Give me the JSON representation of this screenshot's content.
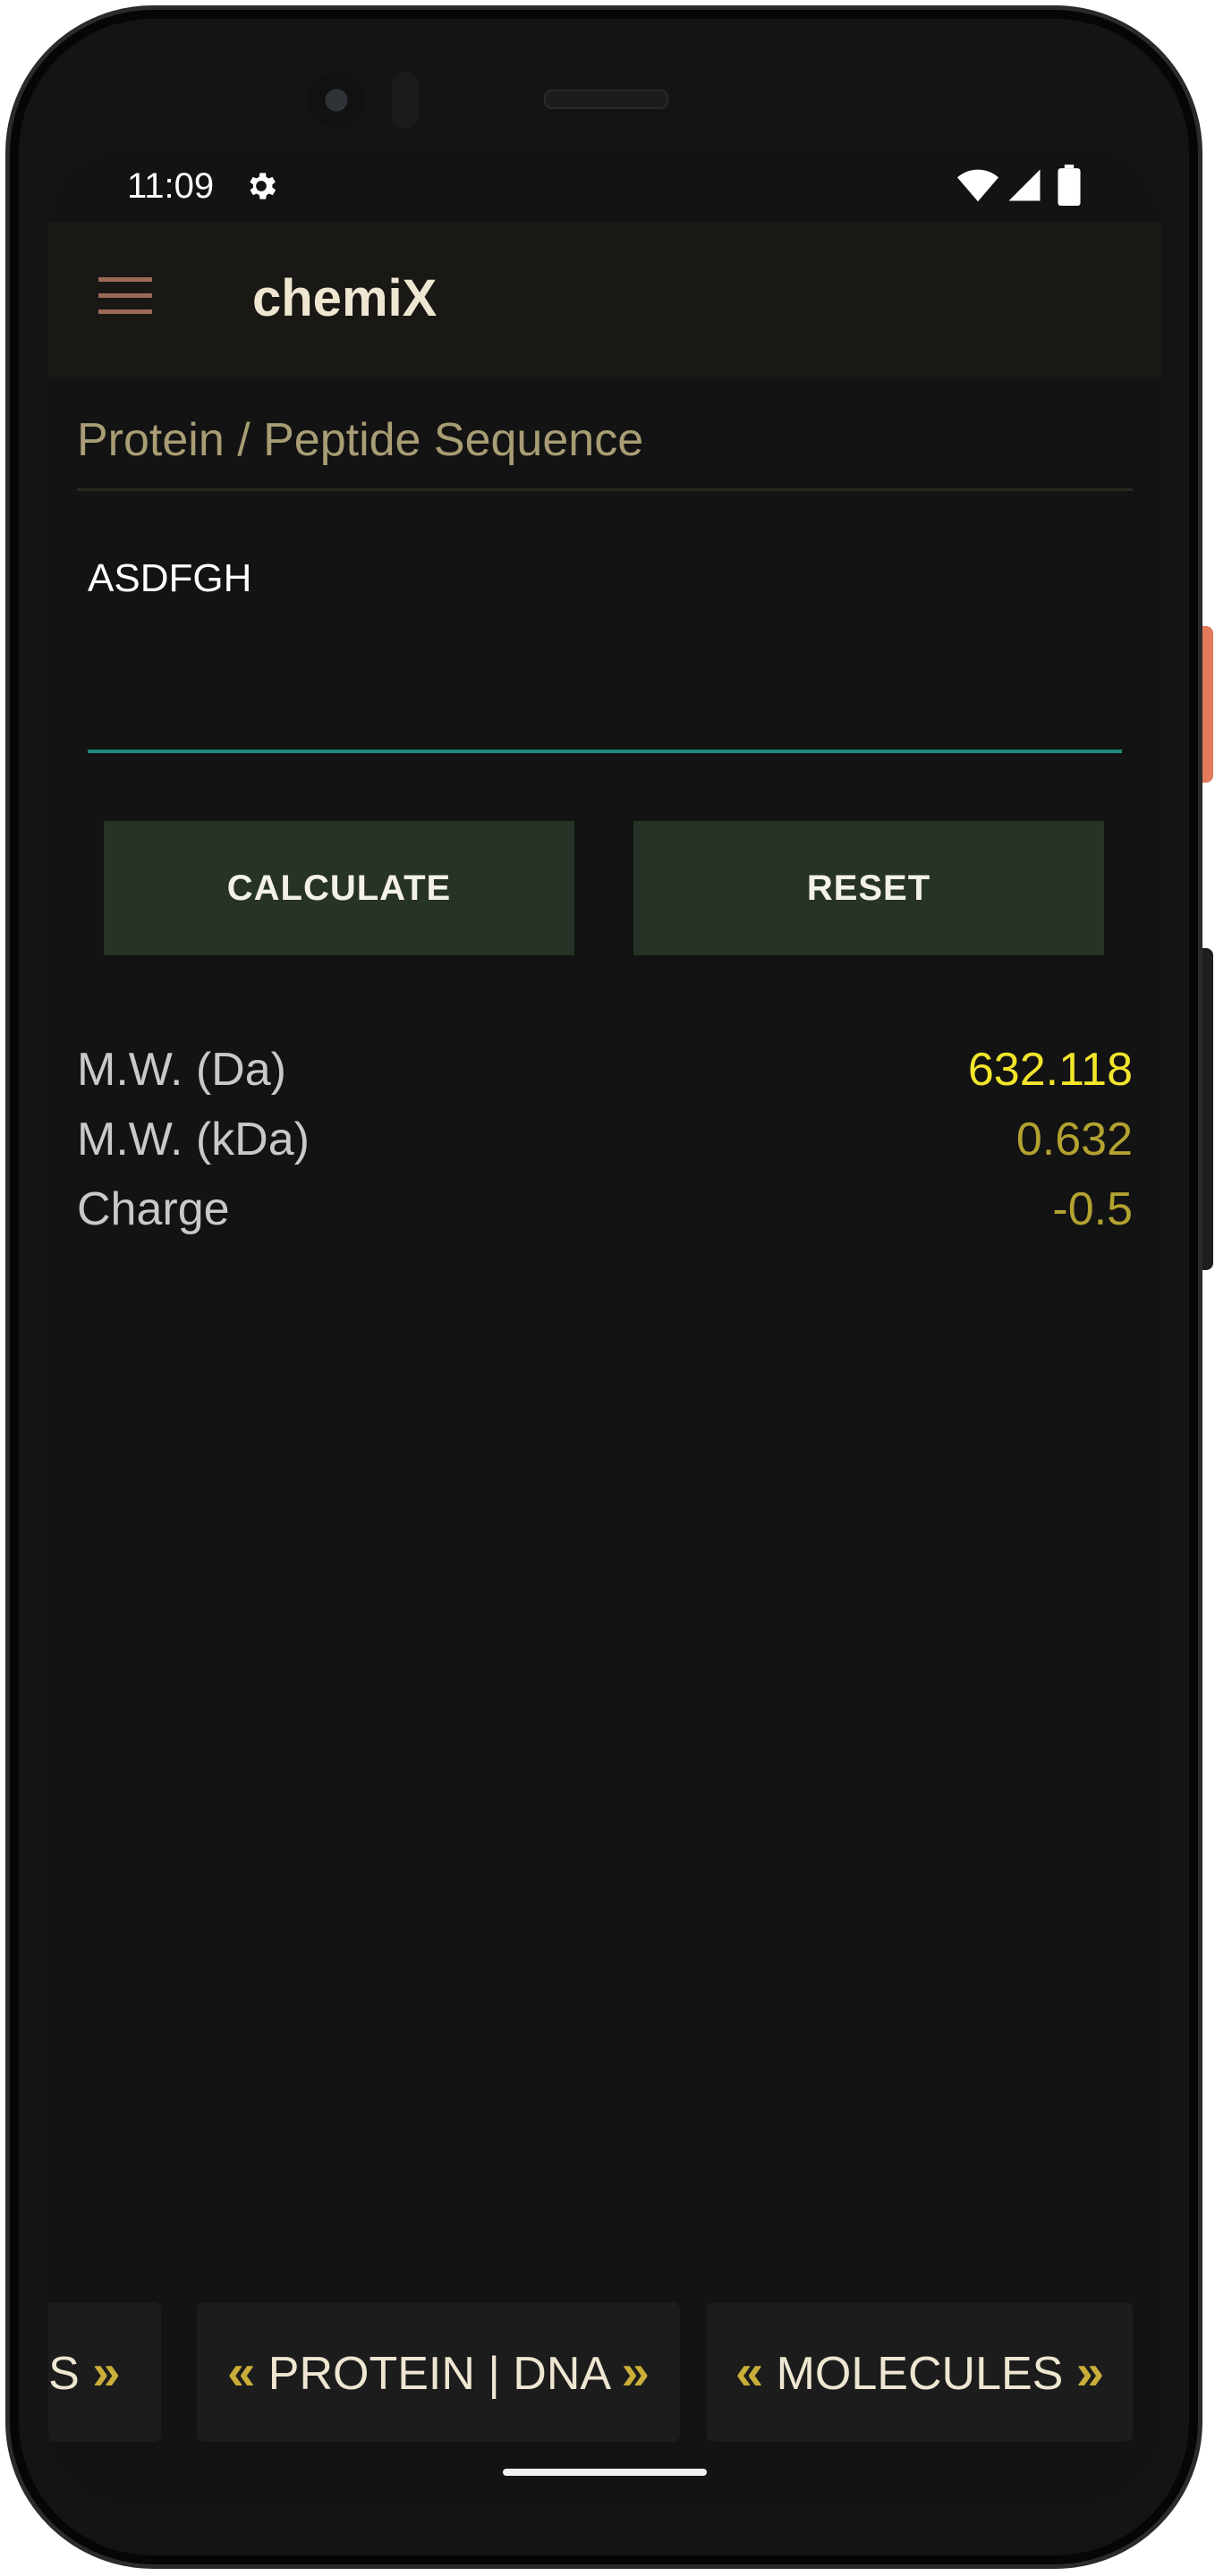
{
  "status_bar": {
    "time": "11:09",
    "icons": [
      "gear-icon",
      "wifi-icon",
      "signal-icon",
      "battery-icon"
    ]
  },
  "app_bar": {
    "title": "chemiX",
    "menu_icon": "hamburger-menu-icon"
  },
  "form": {
    "field_label": "Protein / Peptide Sequence",
    "sequence_value": "ASDFGH",
    "calculate_label": "CALCULATE",
    "reset_label": "RESET"
  },
  "results": [
    {
      "label": "M.W. (Da)",
      "value": "632.118",
      "color": "#f2e52b"
    },
    {
      "label": "M.W. (kDa)",
      "value": "0.632",
      "color": "#b3a230"
    },
    {
      "label": "Charge",
      "value": "-0.5",
      "color": "#b3a230"
    }
  ],
  "bottom_tabs": {
    "prev_label": "IS",
    "protein_label": "PROTEIN | DNA",
    "molecules_label": "MOLECULES"
  },
  "colors": {
    "background": "#131313",
    "accent_teal": "#1f8a7c",
    "button_bg": "#263326",
    "chevron_gold": "#c9ae3a"
  }
}
